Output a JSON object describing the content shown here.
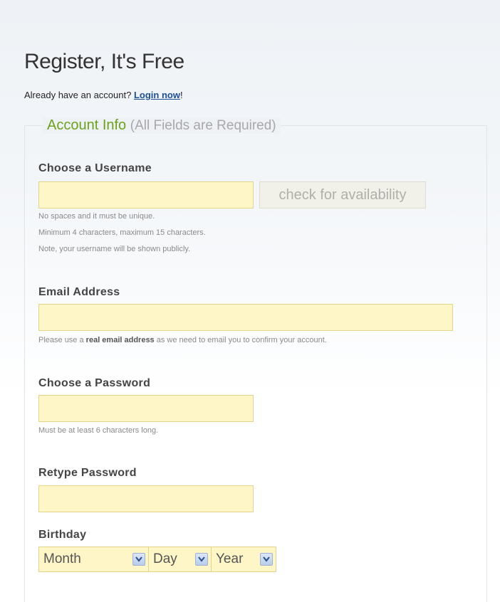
{
  "page": {
    "title": "Register, It's Free",
    "login_prompt": "Already have an account?",
    "login_link": "Login now",
    "login_suffix": "!"
  },
  "account_info": {
    "legend_title": "Account Info",
    "legend_note": "(All Fields are Required)"
  },
  "username": {
    "label": "Choose a Username",
    "value": "",
    "check_button": "check for availability",
    "hints": [
      "No spaces and it must be unique.",
      "Minimum 4 characters, maximum 15 characters.",
      "Note, your username will be shown publicly."
    ]
  },
  "email": {
    "label": "Email Address",
    "value": "",
    "hint_prefix": "Please use a",
    "hint_bold": "real email address",
    "hint_suffix": "as we need to email you to confirm your account."
  },
  "password": {
    "label": "Choose a Password",
    "value": "",
    "hint": "Must be at least 6 characters long."
  },
  "retype_password": {
    "label": "Retype Password",
    "value": ""
  },
  "birthday": {
    "label": "Birthday",
    "month": "Month",
    "day": "Day",
    "year": "Year"
  },
  "colors": {
    "legend_green": "#6aa31a",
    "input_bg": "#fff6c8",
    "link_blue": "#1a4f95"
  },
  "icons": {
    "dropdown": "chevron-down-icon"
  }
}
